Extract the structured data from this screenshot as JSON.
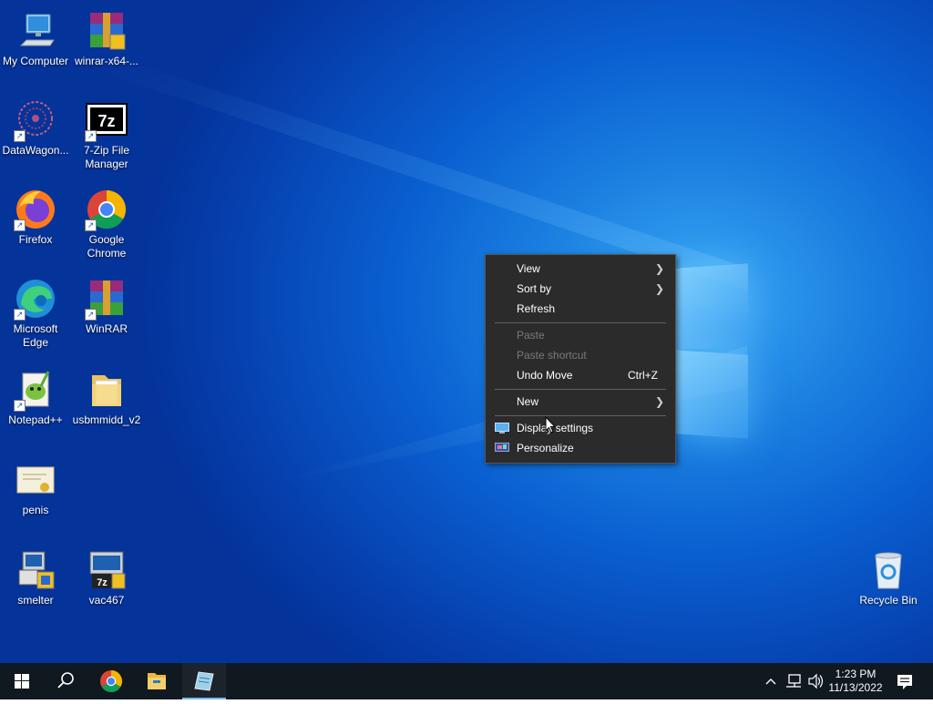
{
  "desktop": {
    "icons": [
      {
        "label": "My Computer",
        "icon": "computer-icon"
      },
      {
        "label": "winrar-x64-...",
        "icon": "winrar-installer-icon"
      },
      {
        "label": "DataWagon...",
        "icon": "datawagon-icon"
      },
      {
        "label": "7-Zip File Manager",
        "icon": "7zip-icon"
      },
      {
        "label": "Firefox",
        "icon": "firefox-icon"
      },
      {
        "label": "Google Chrome",
        "icon": "chrome-icon"
      },
      {
        "label": "Microsoft Edge",
        "icon": "edge-icon"
      },
      {
        "label": "WinRAR",
        "icon": "winrar-icon"
      },
      {
        "label": "Notepad++",
        "icon": "notepadpp-icon"
      },
      {
        "label": "usbmmidd_v2",
        "icon": "folder-icon"
      },
      {
        "label": "penis",
        "icon": "certificate-icon"
      },
      {
        "label": "smelter",
        "icon": "installer-icon"
      },
      {
        "label": "vac467",
        "icon": "7z-installer-icon"
      },
      {
        "label": "Recycle Bin",
        "icon": "recycle-bin-icon"
      }
    ]
  },
  "context_menu": {
    "view": "View",
    "sort_by": "Sort by",
    "refresh": "Refresh",
    "paste": "Paste",
    "paste_shortcut": "Paste shortcut",
    "undo_move": "Undo Move",
    "undo_shortcut": "Ctrl+Z",
    "new": "New",
    "display_settings": "Display settings",
    "personalize": "Personalize"
  },
  "taskbar": {
    "time": "1:23 PM",
    "date": "11/13/2022",
    "apps": [
      "start-icon",
      "search-icon",
      "chrome-icon",
      "file-explorer-icon",
      "notepad-app-icon"
    ]
  },
  "colors": {
    "menu_bg": "#2b2b2b",
    "taskbar_bg": "#101820",
    "accent": "#76b9ed"
  }
}
